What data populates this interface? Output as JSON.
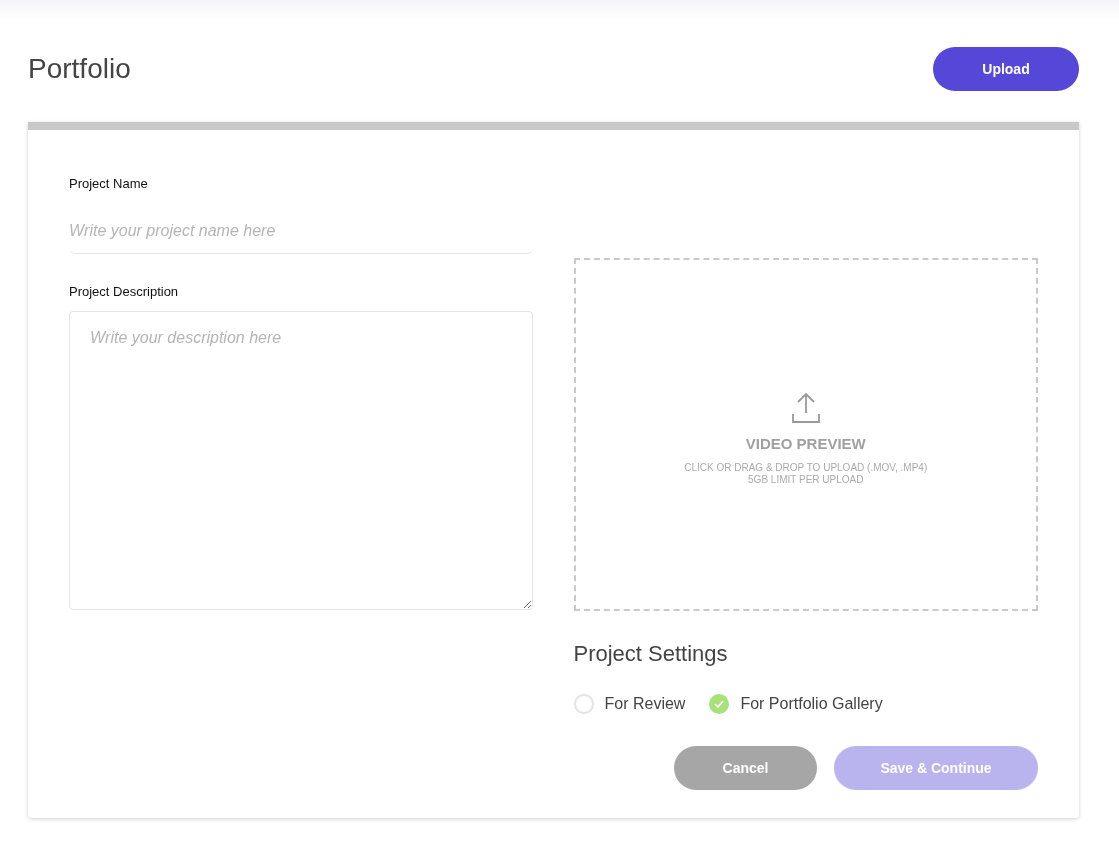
{
  "page": {
    "title": "Portfolio"
  },
  "upload_button": {
    "label": "Upload"
  },
  "form": {
    "name_label": "Project Name",
    "name_placeholder": "Write your project name here",
    "description_label": "Project Description",
    "description_placeholder": "Write your description here"
  },
  "dropzone": {
    "title": "VIDEO PREVIEW",
    "hint_lines": [
      "CLICK OR DRAG & DROP TO UPLOAD (.MOV, .MP4)",
      "5GB LIMIT PER UPLOAD"
    ]
  },
  "settings": {
    "title": "Project Settings",
    "options": [
      {
        "label": "For Review",
        "selected": false
      },
      {
        "label": "For Portfolio Gallery",
        "selected": true
      }
    ]
  },
  "buttons": [
    {
      "label": "Cancel",
      "kind": "secondary",
      "disabled": false
    },
    {
      "label": "Save & Continue",
      "kind": "primary",
      "disabled": true
    }
  ]
}
